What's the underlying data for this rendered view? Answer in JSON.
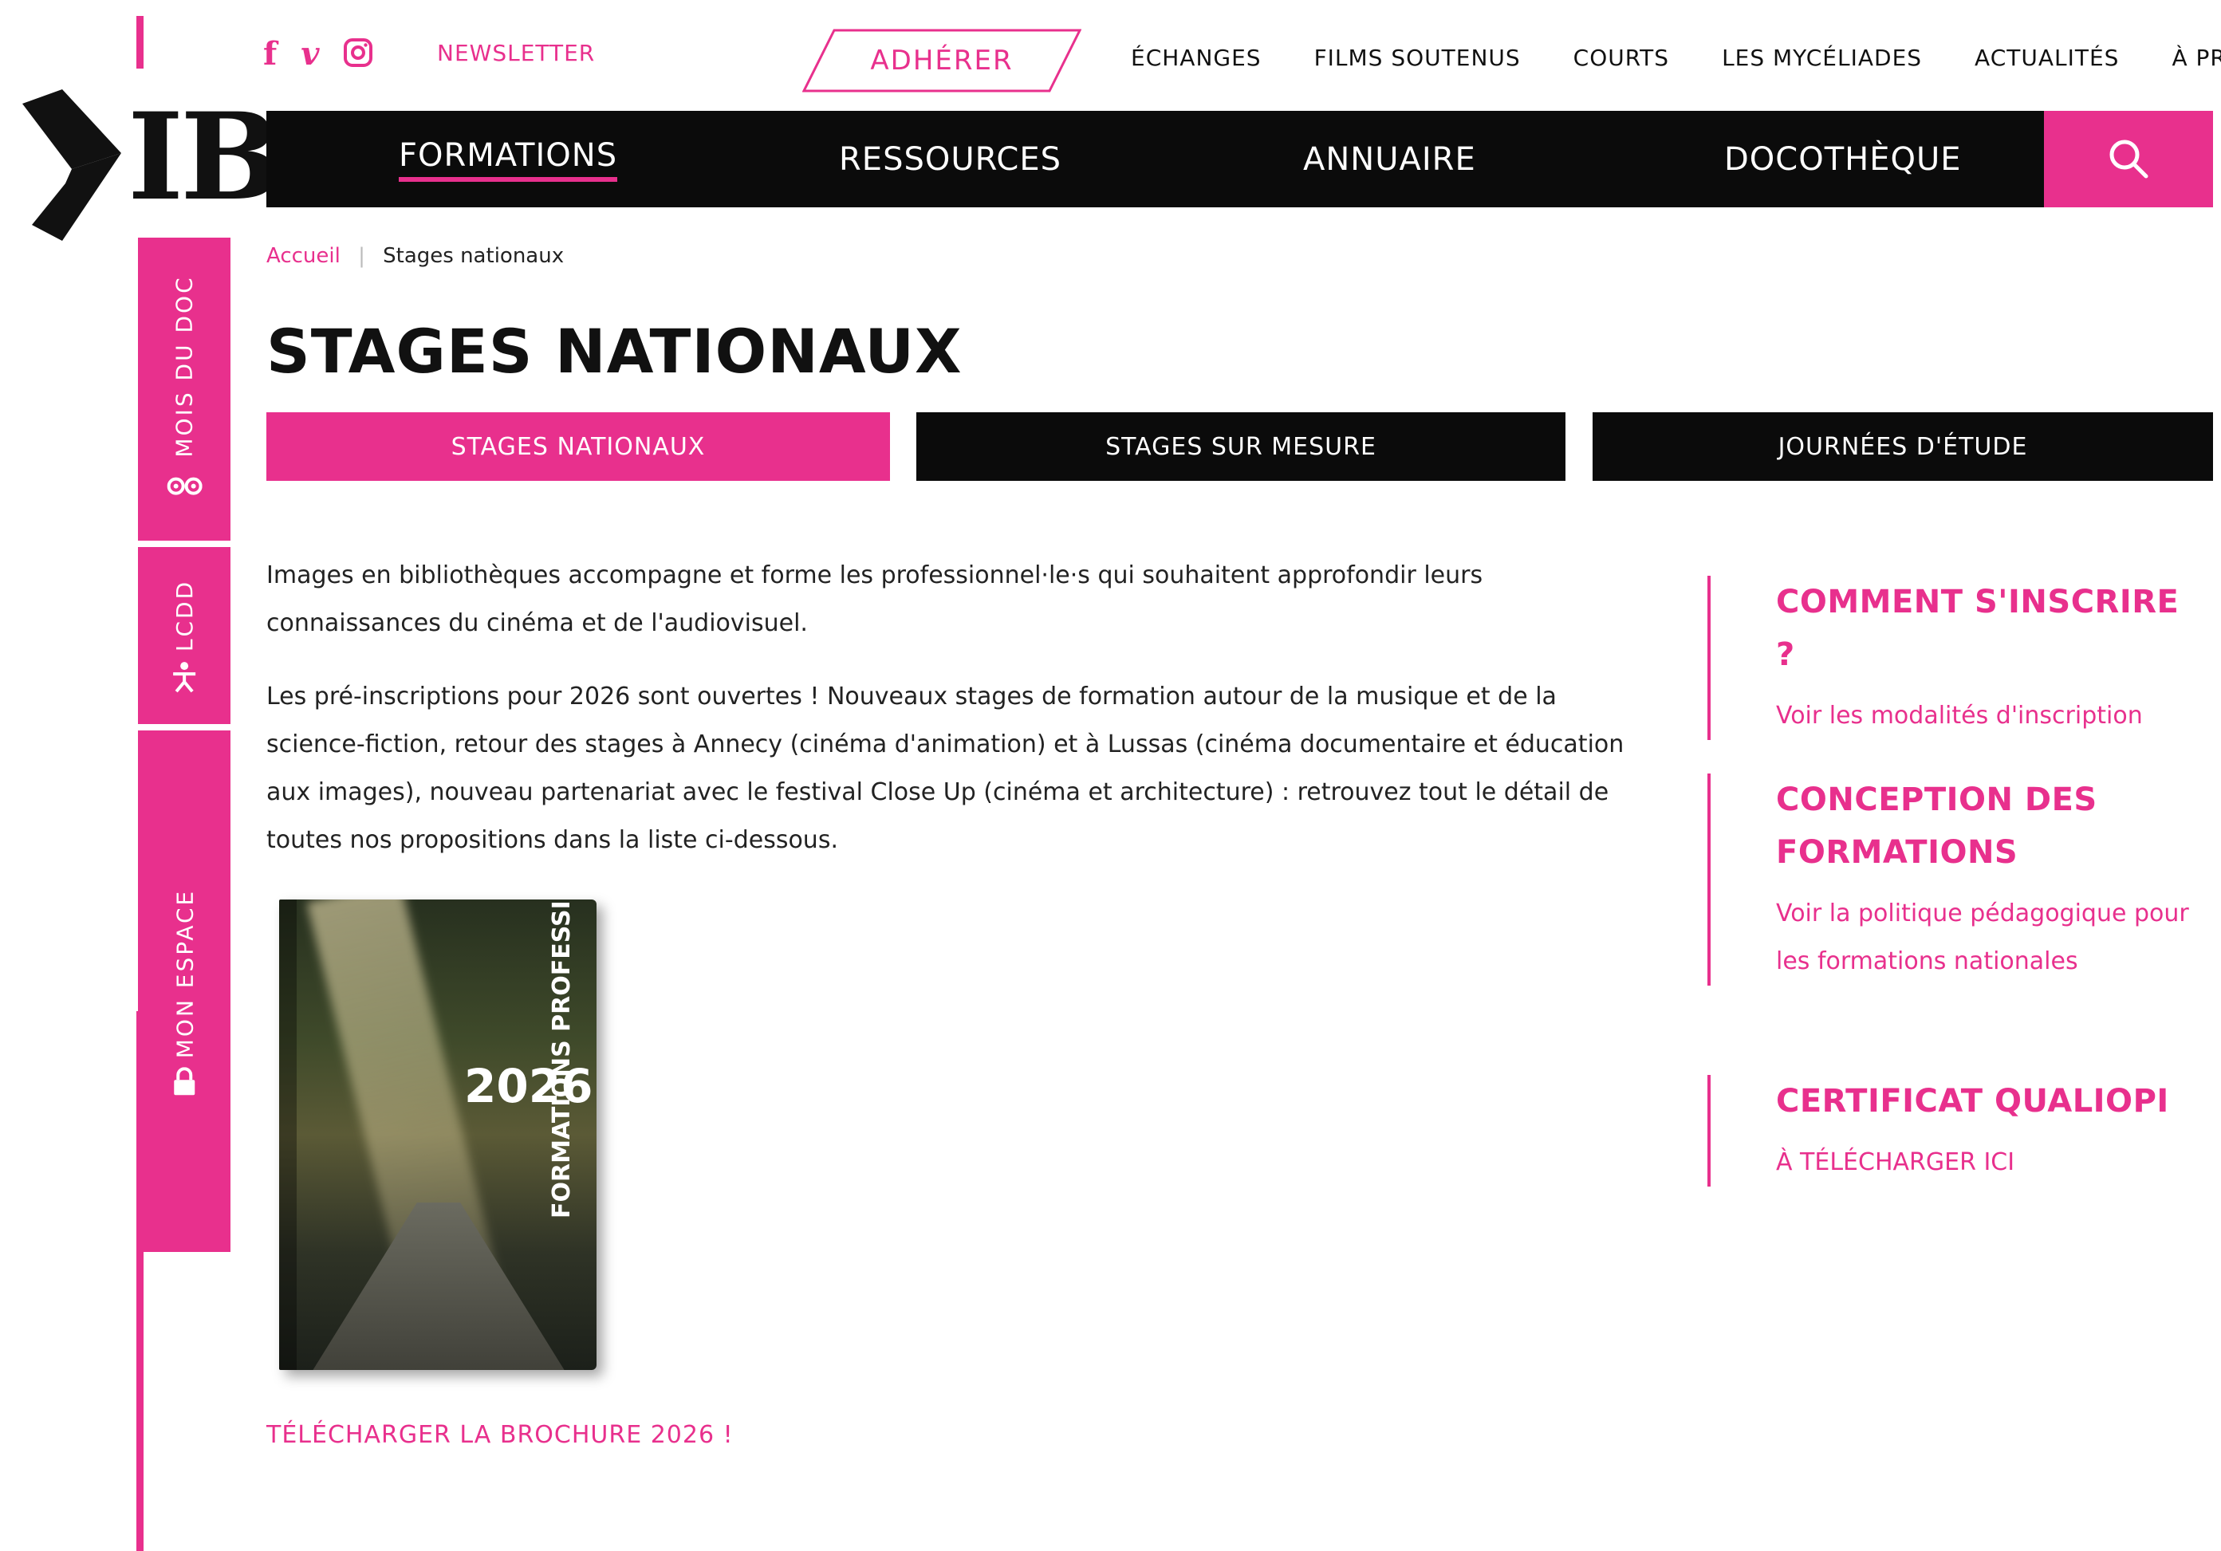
{
  "social": {
    "facebook": "f",
    "vimeo": "v",
    "instagram_icon": "instagram-icon",
    "newsletter": "NEWSLETTER"
  },
  "header": {
    "adherer": "ADHÉRER",
    "top_nav": [
      "ÉCHANGES",
      "FILMS SOUTENUS",
      "COURTS",
      "LES MYCÉLIADES",
      "ACTUALITÉS",
      "À PROPOS"
    ],
    "logo_text": "IB",
    "main_nav": [
      "FORMATIONS",
      "RESSOURCES",
      "ANNUAIRE",
      "DOCOTHÈQUE"
    ],
    "search_icon": "search-icon"
  },
  "side_tabs": [
    {
      "label": "MOIS DU DOC",
      "icon": "glasses-icon"
    },
    {
      "label": "LCDD",
      "icon": "figure-icon"
    },
    {
      "label": "MON ESPACE",
      "icon": "lock-icon"
    }
  ],
  "breadcrumb": {
    "home": "Accueil",
    "separator": "|",
    "current": "Stages nationaux"
  },
  "page_title": "STAGES NATIONAUX",
  "tabs": [
    "STAGES NATIONAUX",
    "STAGES SUR MESURE",
    "JOURNÉES D'ÉTUDE"
  ],
  "intro": {
    "p1": "Images en bibliothèques accompagne et forme les professionnel·le·s qui souhaitent approfondir leurs connaissances du cinéma et de l'audiovisuel.",
    "p2": "Les pré-inscriptions pour 2026 sont ouvertes ! Nouveaux stages de formation autour de la musique et de la science-fiction, retour des stages à Annecy (cinéma d'animation) et à Lussas (cinéma documentaire et éducation aux images), nouveau partenariat avec le festival Close Up (cinéma et architecture) : retrouvez tout le détail de toutes nos propositions dans la liste ci-dessous."
  },
  "brochure": {
    "year": "2026",
    "title": "FORMATIONS PROFESSIONNELLES",
    "download": "TÉLÉCHARGER LA BROCHURE 2026 !"
  },
  "sidebar": [
    {
      "heading": "COMMENT S'INSCRIRE ?",
      "link": "Voir les modalités d'inscription"
    },
    {
      "heading": "CONCEPTION DES FORMATIONS",
      "link": "Voir la politique pédagogique pour les formations nationales"
    },
    {
      "heading": "CERTIFICAT QUALIOPI",
      "link": "À TÉLÉCHARGER ICI"
    }
  ],
  "colors": {
    "accent": "#e8308d",
    "nav_bg": "#0b0b0b"
  }
}
